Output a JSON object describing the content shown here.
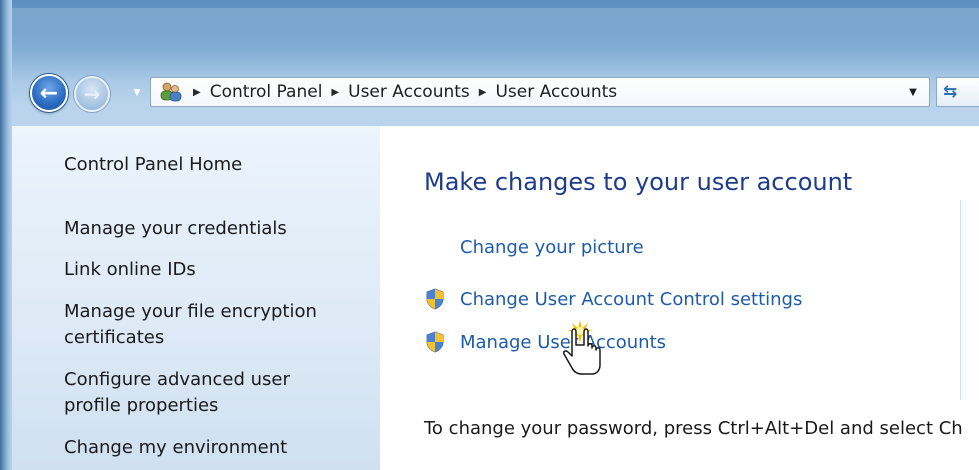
{
  "window": {
    "accent": "#6f9fca",
    "back_icon": "back-arrow-icon",
    "forward_icon": "forward-arrow-icon"
  },
  "address_bar": {
    "icon": "user-accounts-icon",
    "crumbs": [
      "Control Panel",
      "User Accounts",
      "User Accounts"
    ]
  },
  "sidebar": {
    "items": [
      {
        "label": "Control Panel Home"
      },
      {
        "label": "Manage your credentials"
      },
      {
        "label": "Link online IDs"
      },
      {
        "label": "Manage your file encryption"
      },
      {
        "label": "certificates"
      },
      {
        "label": "Configure advanced user"
      },
      {
        "label": "profile properties"
      },
      {
        "label": "Change my environment"
      }
    ]
  },
  "main": {
    "heading": "Make changes to your user account",
    "tasks": [
      {
        "label": "Change your picture",
        "icon": ""
      },
      {
        "label": "Change User Account Control settings",
        "icon": "uac-shield-icon"
      },
      {
        "label": "Manage User Accounts",
        "icon": "uac-shield-icon"
      }
    ],
    "info": "To change your password, press Ctrl+Alt+Del and select Ch",
    "link_color": "#1e5ba8",
    "heading_color": "#1e3c8c"
  }
}
